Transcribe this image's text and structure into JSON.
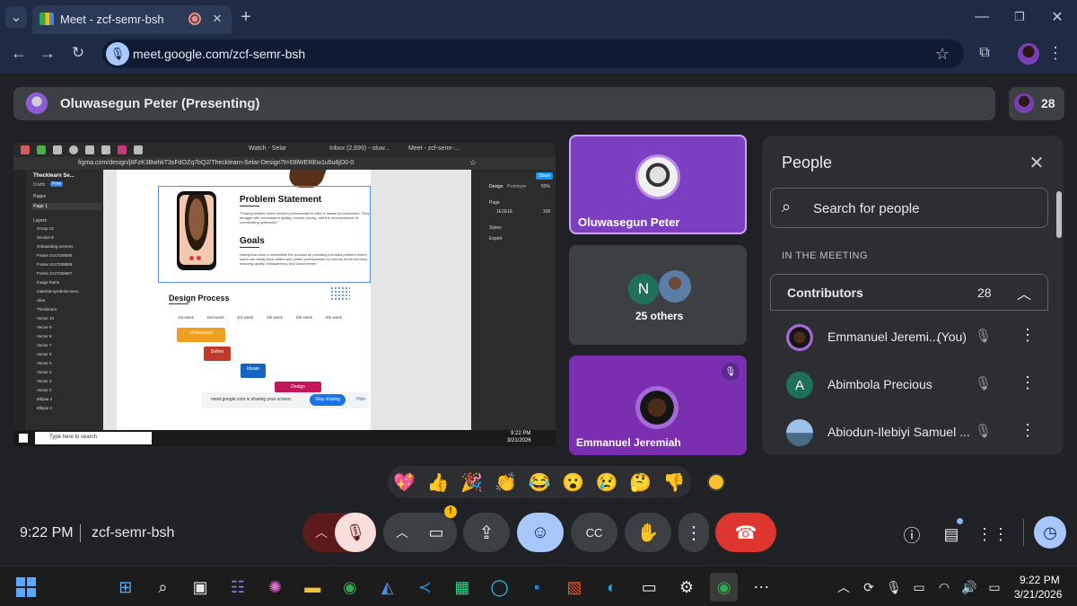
{
  "browser": {
    "tab_title": "Meet - zcf-semr-bsh",
    "url": "meet.google.com/zcf-semr-bsh",
    "new_tab": "+"
  },
  "meet": {
    "presenter_label": "Oluwasegun Peter (Presenting)",
    "participant_count": "28",
    "tiles": [
      {
        "name": "Oluwasegun Peter"
      },
      {
        "name": "25 others",
        "initial": "N"
      },
      {
        "name": "Emmanuel Jeremiah"
      }
    ],
    "people_panel": {
      "title": "People",
      "search_placeholder": "Search for people",
      "section_label": "IN THE MEETING",
      "group_label": "Contributors",
      "group_count": "28",
      "people": [
        {
          "name": "Emmanuel Jeremi...",
          "suffix": "(You)"
        },
        {
          "name": "Abimbola Precious",
          "initial": "A"
        },
        {
          "name": "Abiodun-Ilebiyi Samuel ..."
        }
      ]
    },
    "reactions": [
      "💖",
      "👍",
      "🎉",
      "👏",
      "😂",
      "😮",
      "😢",
      "🤔",
      "👎"
    ],
    "time": "9:22 PM",
    "meeting_code": "zcf-semr-bsh"
  },
  "shared_screen": {
    "url": "figma.com/design/j8FzK3BwhkT3sFdOZq7bQ2/Thecklearn-Selar-Design?t=69lWEREw1u5u8jD0-0",
    "tabs": [
      "Watch - Selar",
      "Inbox (2,699) - oluw...",
      "Meet - zcf-semr-..."
    ],
    "file_name": "Thecklearn Se...",
    "drafts": "Drafts",
    "free": "Free",
    "pages_label": "Pages",
    "page1": "Page 1",
    "layers_label": "Layers",
    "layers": [
      "Group 13",
      "Section 8",
      "Onboarding screens",
      "Frame 2147238590",
      "Frame 2147238588",
      "Frame 2147238587",
      "Image frame",
      "material-symbols:menu",
      "olive",
      "Thecklearn",
      "Vector 10",
      "Vector 9",
      "Vector 8",
      "Vector 7",
      "Vector 6",
      "Vector 5",
      "Vector 4",
      "Vector 3",
      "Vector 2",
      "Ellipse 3",
      "Ellipse 2"
    ],
    "problem_title": "Problem Statement",
    "problem_body": "\"Finding reliable home service professionals is often a hassle for customers. They struggle with inconsistent quality, unclear pricing, and the inconvenience of coordinating schedules.\"",
    "goals_title": "Goals",
    "goals_body": "HandyNow aims to streamline the process by providing a trusted platform where users can easily book skilled and vetted professionals for various home services, ensuring quality, transparency, and convenience.\"",
    "design_process_title": "Design Process",
    "weeks": [
      "1st week",
      "2nd week",
      "3rd week",
      "4th week",
      "5th week",
      "6th week"
    ],
    "phases": [
      "Understand",
      "Define",
      "Ideate",
      "Design"
    ],
    "design_tab": "Design",
    "prototype_tab": "Prototype",
    "share": "Share",
    "zoom": "50%",
    "page_label": "Page",
    "page_color": "1E1E1E",
    "page_opacity": "100",
    "styles_label": "Styles",
    "export_label": "Export",
    "sharing_notice": "meet.google.com is sharing your screen.",
    "stop_sharing": "Stop sharing",
    "hide": "Hide",
    "search_placeholder": "Type here to search",
    "time": "9:22 PM",
    "date": "3/21/2026",
    "canvas_tag": "Cover Draw"
  },
  "taskbar": {
    "time": "9:22 PM",
    "date": "3/21/2026"
  }
}
